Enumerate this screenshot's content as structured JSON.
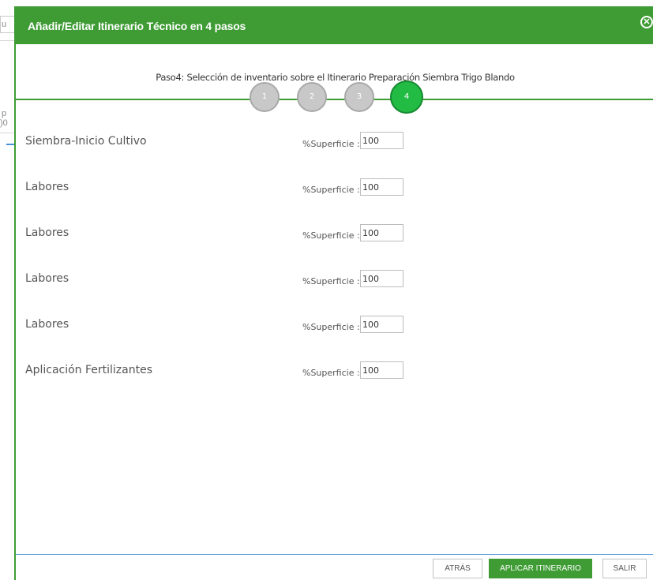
{
  "modal": {
    "title": "Añadir/Editar Itinerario Técnico en 4 pasos",
    "close_symbol": "✕",
    "step_caption": "Paso4: Selección de inventario sobre el Itinerario Preparación Siembra Trigo Blando",
    "steps": [
      {
        "number": "1",
        "state": "inactive"
      },
      {
        "number": "2",
        "state": "inactive"
      },
      {
        "number": "3",
        "state": "inactive"
      },
      {
        "number": "4",
        "state": "active"
      }
    ],
    "surface_label": "%Superficie :",
    "rows": [
      {
        "label": "Siembra-Inicio Cultivo",
        "value": "100"
      },
      {
        "label": "Labores",
        "value": "100"
      },
      {
        "label": "Labores",
        "value": "100"
      },
      {
        "label": "Labores",
        "value": "100"
      },
      {
        "label": "Labores",
        "value": "100"
      },
      {
        "label": "Aplicación Fertilizantes",
        "value": "100"
      }
    ],
    "buttons": {
      "back": "ATRÁS",
      "apply": "APLICAR ITINERARIO",
      "exit": "SALIR"
    }
  },
  "background": {
    "frag_u": "u",
    "frag_p": "p",
    "frag_0": ")0"
  },
  "colors": {
    "header": "#3f9c35",
    "active_step": "#22bb44",
    "inactive_step": "#c8c8c8",
    "footer_line": "#4a90d9"
  },
  "icons": {
    "close": "close-circle-icon"
  }
}
